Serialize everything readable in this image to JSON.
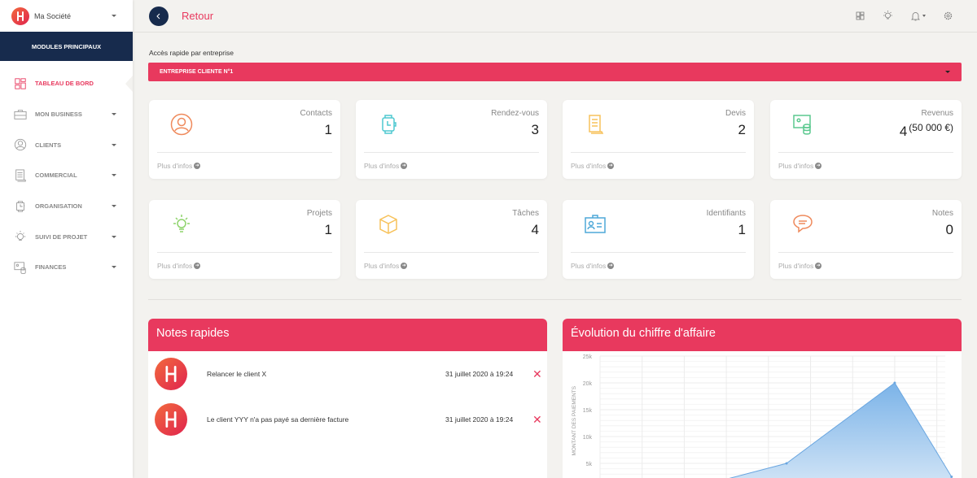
{
  "sidebar": {
    "company": "Ma Société",
    "section": "MODULES PRINCIPAUX",
    "items": [
      {
        "label": "TABLEAU DE BORD",
        "icon": "dashboard-icon"
      },
      {
        "label": "MON BUSINESS",
        "icon": "briefcase-icon"
      },
      {
        "label": "CLIENTS",
        "icon": "user-icon"
      },
      {
        "label": "COMMERCIAL",
        "icon": "document-icon"
      },
      {
        "label": "ORGANISATION",
        "icon": "watch-icon"
      },
      {
        "label": "SUIVI DE PROJET",
        "icon": "lightbulb-icon"
      },
      {
        "label": "FINANCES",
        "icon": "money-icon"
      }
    ]
  },
  "header": {
    "back_label": "Retour"
  },
  "quick_access": {
    "label": "Accès rapide par entreprise",
    "selected": "ENTREPRISE CLIENTE N°1"
  },
  "cards": [
    {
      "label": "Contacts",
      "value": "1",
      "more": "Plus d'infos",
      "color": "#ef8a5c"
    },
    {
      "label": "Rendez-vous",
      "value": "3",
      "more": "Plus d'infos",
      "color": "#4fc9d0"
    },
    {
      "label": "Devis",
      "value": "2",
      "more": "Plus d'infos",
      "color": "#f7c25b"
    },
    {
      "label": "Revenus",
      "value": "4",
      "extra": "(50 000 €)",
      "more": "Plus d'infos",
      "color": "#5bc98f"
    },
    {
      "label": "Projets",
      "value": "1",
      "more": "Plus d'infos",
      "color": "#8ed36b"
    },
    {
      "label": "Tâches",
      "value": "4",
      "more": "Plus d'infos",
      "color": "#f7c25b"
    },
    {
      "label": "Identifiants",
      "value": "1",
      "more": "Plus d'infos",
      "color": "#4fa8d8"
    },
    {
      "label": "Notes",
      "value": "0",
      "more": "Plus d'infos",
      "color": "#ef8a5c"
    }
  ],
  "notes": {
    "title": "Notes rapides",
    "items": [
      {
        "text": "Relancer le client X",
        "date": "31 juillet 2020 à 19:24"
      },
      {
        "text": "Le client YYY n'a pas payé sa dernière facture",
        "date": "31 juillet 2020 à 19:24"
      }
    ]
  },
  "chart_data": {
    "type": "area",
    "title": "Évolution du chiffre d'affaire",
    "ylabel": "MONTANT DES PAIEMENTS",
    "yticks": [
      "25k",
      "20k",
      "15k",
      "10k",
      "5k"
    ],
    "ylim": [
      0,
      25000
    ],
    "x": [
      0,
      1,
      2,
      4.43,
      7,
      8.35
    ],
    "values": [
      0,
      0,
      0,
      5000,
      20000,
      2500
    ],
    "xlim": [
      0,
      8.2
    ]
  }
}
